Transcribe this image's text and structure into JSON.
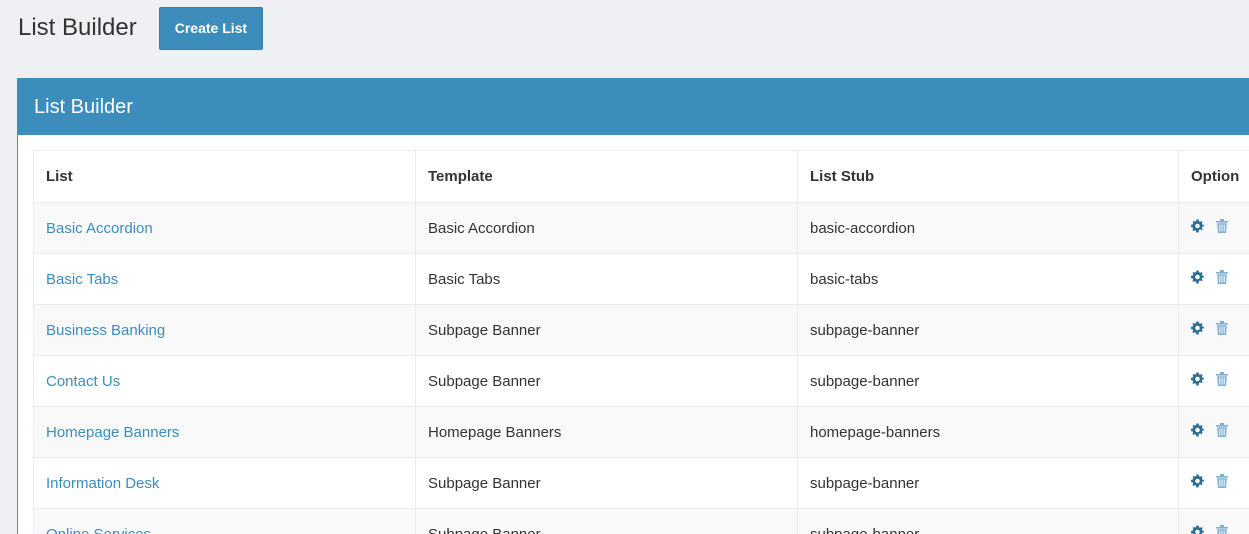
{
  "header": {
    "title": "List Builder",
    "create_button": "Create List"
  },
  "panel": {
    "title": "List Builder"
  },
  "table": {
    "columns": [
      "List",
      "Template",
      "List Stub",
      "Option"
    ],
    "rows": [
      {
        "list": "Basic Accordion",
        "template": "Basic Accordion",
        "stub": "basic-accordion"
      },
      {
        "list": "Basic Tabs",
        "template": "Basic Tabs",
        "stub": "basic-tabs"
      },
      {
        "list": "Business Banking",
        "template": "Subpage Banner",
        "stub": "subpage-banner"
      },
      {
        "list": "Contact Us",
        "template": "Subpage Banner",
        "stub": "subpage-banner"
      },
      {
        "list": "Homepage Banners",
        "template": "Homepage Banners",
        "stub": "homepage-banners"
      },
      {
        "list": "Information Desk",
        "template": "Subpage Banner",
        "stub": "subpage-banner"
      },
      {
        "list": "Online Services",
        "template": "Subpage Banner",
        "stub": "subpage-banner"
      }
    ],
    "row_icons": [
      "gear-icon",
      "trash-icon"
    ]
  },
  "colors": {
    "accent": "#3c8dbc",
    "background": "#eef0f4",
    "link": "#3c8dbc",
    "gear_icon": "#2e6d96",
    "trash_icon": "#7fb1d3"
  }
}
